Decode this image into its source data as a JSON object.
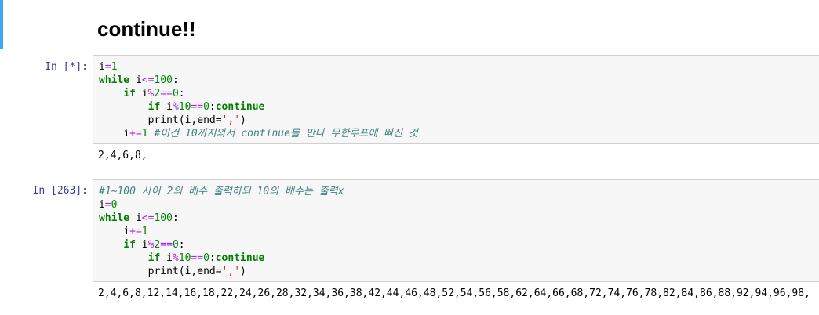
{
  "markdown": {
    "title": "continue!!"
  },
  "cells": [
    {
      "prompt": "In [*]:",
      "code": {
        "line1": {
          "var": "i",
          "op": "=",
          "num": "1"
        },
        "line2": {
          "kw": "while",
          "a": " i",
          "op": "<=",
          "num": "100",
          "colon": ":"
        },
        "line3": {
          "indent": "    ",
          "kw": "if",
          "a": " i",
          "op1": "%",
          "num1": "2",
          "op2": "==",
          "num2": "0",
          "colon": ":"
        },
        "line4": {
          "indent": "        ",
          "kw": "if",
          "a": " i",
          "op1": "%",
          "num1": "10",
          "op2": "==",
          "num2": "0",
          "colon": ":",
          "kw2": "continue"
        },
        "line5": {
          "indent": "        ",
          "fn": "print(i,end=",
          "str": "','",
          "close": ")"
        },
        "line6": {
          "indent": "    ",
          "var": "i",
          "op": "+=",
          "num": "1",
          "comment": " #이건 10까지와서 continue를 만나 무한루프에 빠진 것"
        }
      },
      "output": "2,4,6,8,"
    },
    {
      "prompt": "In [263]:",
      "code": {
        "line1": {
          "comment": "#1~100 사이 2의 배수 출력하되 10의 배수는 출력x"
        },
        "line2": {
          "var": "i",
          "op": "=",
          "num": "0"
        },
        "line3": {
          "kw": "while",
          "a": " i",
          "op": "<=",
          "num": "100",
          "colon": ":"
        },
        "line4": {
          "indent": "    ",
          "var": "i",
          "op": "+=",
          "num": "1"
        },
        "line5": {
          "indent": "    ",
          "kw": "if",
          "a": " i",
          "op1": "%",
          "num1": "2",
          "op2": "==",
          "num2": "0",
          "colon": ":"
        },
        "line6": {
          "indent": "        ",
          "kw": "if",
          "a": " i",
          "op1": "%",
          "num1": "10",
          "op2": "==",
          "num2": "0",
          "colon": ":",
          "kw2": "continue"
        },
        "line7": {
          "indent": "        ",
          "fn": "print(i,end=",
          "str": "','",
          "close": ")"
        }
      },
      "output": "2,4,6,8,12,14,16,18,22,24,26,28,32,34,36,38,42,44,46,48,52,54,56,58,62,64,66,68,72,74,76,78,82,84,86,88,92,94,96,98,"
    }
  ],
  "colors": {
    "accent": "#42a5f5",
    "prompt": "#303f9f",
    "keyword": "#008000",
    "operator": "#aa22ff",
    "string": "#ba2121",
    "comment": "#408080"
  }
}
